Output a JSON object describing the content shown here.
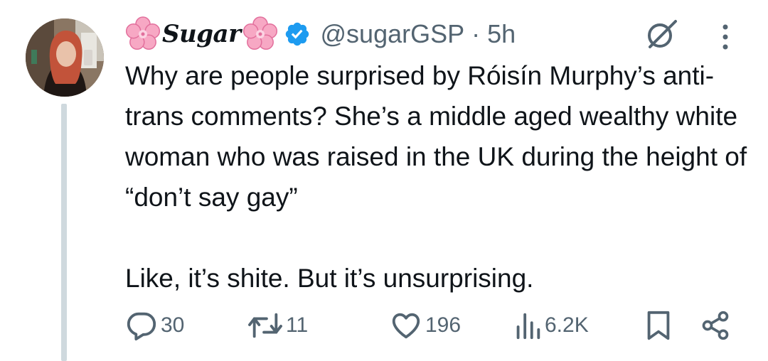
{
  "author": {
    "display_name": "Sugar",
    "handle": "@sugarGSP",
    "separator": "·",
    "timestamp": "5h",
    "verified": true,
    "name_emoji": "cherry-blossom-icon"
  },
  "tweet": {
    "paragraph_1": "Why are people surprised by Róisín Murphy’s anti-trans comments? She’s a middle aged wealthy white woman who was raised in the UK during the height of “don’t say gay”",
    "paragraph_2": "Like, it’s shite. But it’s unsurprising."
  },
  "actions": {
    "replies": "30",
    "reposts": "11",
    "likes": "196",
    "views": "6.2K"
  },
  "colors": {
    "text": "#0f1419",
    "secondary": "#536471",
    "verified": "#1d9bf0",
    "thread_line": "#cfd9de",
    "blossom": "#f7a8c4"
  }
}
